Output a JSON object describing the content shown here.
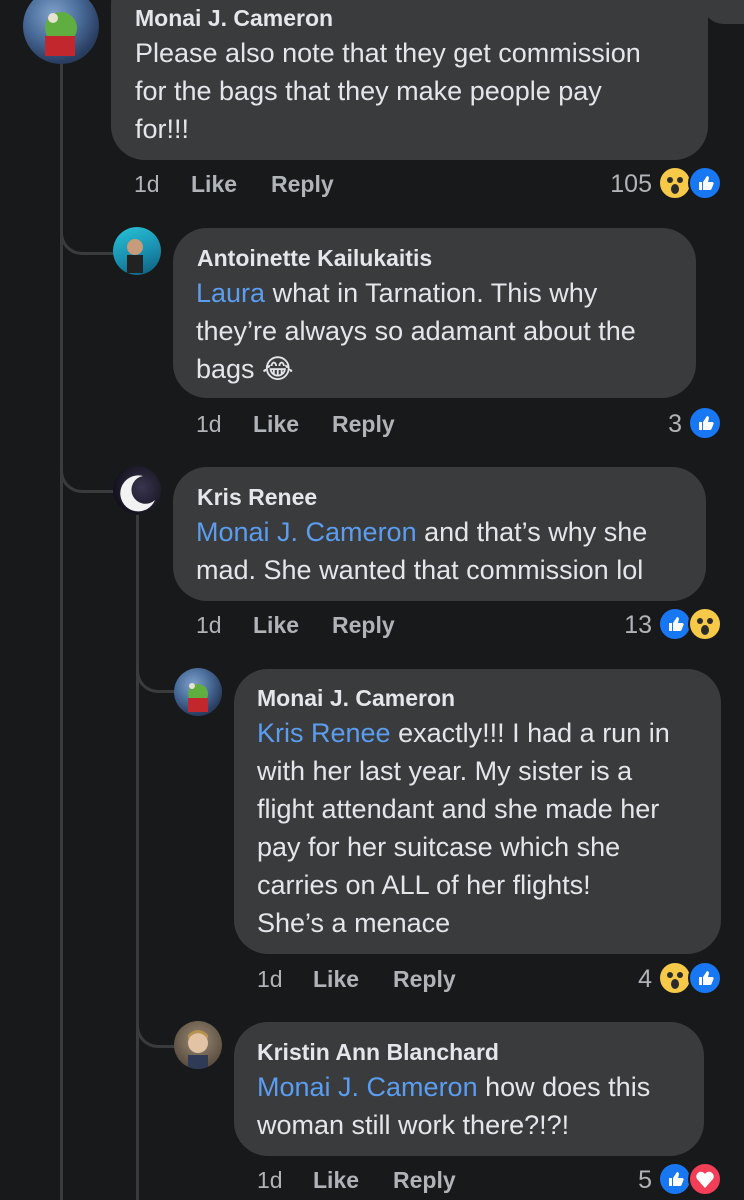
{
  "comments": [
    {
      "author": "Monai J. Cameron",
      "lines": [
        "Please also note that they get commission",
        "for the bags that they make people pay",
        "for!!!"
      ],
      "time": "1d",
      "like": "Like",
      "reply": "Reply",
      "reaction_count": "105",
      "reactions": [
        "wow-icon",
        "like-icon"
      ]
    },
    {
      "author": "Antoinette Kailukaitis",
      "mention": "Laura",
      "lines_after_mention": " what in Tarnation. This why",
      "lines": [
        "they’re always so adamant about the",
        "bags 😂"
      ],
      "time": "1d",
      "like": "Like",
      "reply": "Reply",
      "reaction_count": "3",
      "reactions": [
        "like-icon"
      ]
    },
    {
      "author": "Kris Renee",
      "mention": "Monai J. Cameron",
      "lines_after_mention": " and that’s why she",
      "lines": [
        "mad. She wanted that commission lol"
      ],
      "time": "1d",
      "like": "Like",
      "reply": "Reply",
      "reaction_count": "13",
      "reactions": [
        "like-icon",
        "wow-icon"
      ]
    },
    {
      "author": "Monai J. Cameron",
      "mention": "Kris Renee",
      "lines_after_mention": " exactly!!! I had a run in",
      "lines": [
        "with her last year. My sister is a",
        "flight attendant and she made her",
        "pay for her suitcase which she",
        "carries on ALL of her flights!",
        "She’s a menace"
      ],
      "time": "1d",
      "like": "Like",
      "reply": "Reply",
      "reaction_count": "4",
      "reactions": [
        "wow-icon",
        "like-icon"
      ]
    },
    {
      "author": "Kristin Ann Blanchard",
      "mention": "Monai J. Cameron",
      "lines_after_mention": " how does this",
      "lines": [
        "woman still work there?!?!"
      ],
      "time": "1d",
      "like": "Like",
      "reply": "Reply",
      "reaction_count": "5",
      "reactions": [
        "like-icon",
        "love-icon"
      ]
    }
  ]
}
